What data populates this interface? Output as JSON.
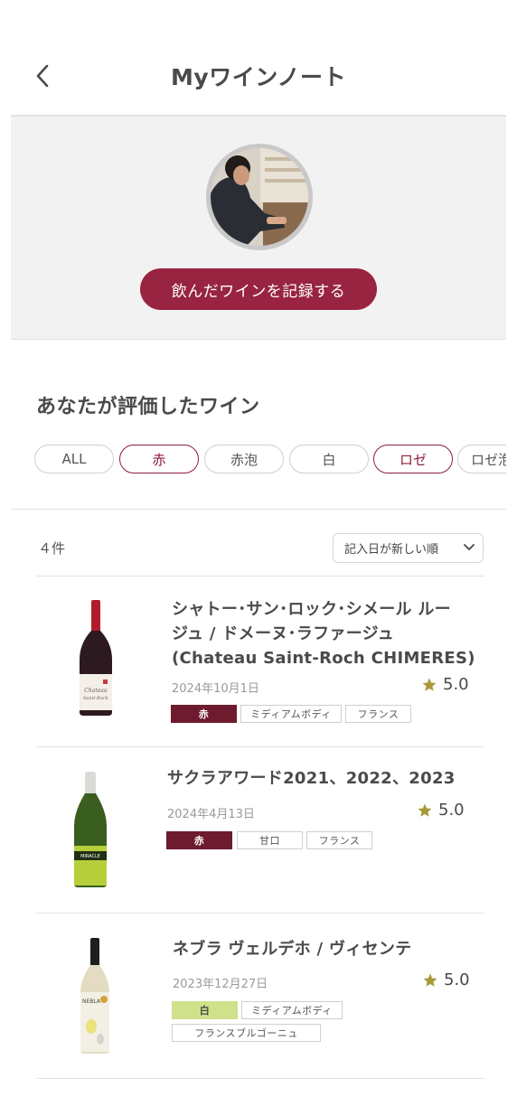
{
  "header": {
    "title": "Myワインノート",
    "back_icon": "chevron-left-icon"
  },
  "profile": {
    "record_button_label": "飲んだワインを記録する"
  },
  "section": {
    "title": "あなたが評価したワイン"
  },
  "filters": [
    {
      "label": "ALL",
      "active": false
    },
    {
      "label": "赤",
      "active": true
    },
    {
      "label": "赤泡",
      "active": false
    },
    {
      "label": "白",
      "active": false
    },
    {
      "label": "ロゼ",
      "active": true
    },
    {
      "label": "ロゼ泡",
      "active": false
    }
  ],
  "list": {
    "count": "４件",
    "sort_label": "記入日が新しい順"
  },
  "colors": {
    "accent": "#982441",
    "red_tag": "#6e1b30",
    "white_tag": "#cfe18b",
    "star": "#a89a3a"
  },
  "wines": [
    {
      "name_line1": "シャトー･サン･ロック･シメール ルー",
      "name_line2": "ジュ / ドメーヌ･ラファージュ",
      "name_line3": "(Chateau Saint-Roch CHIMERES)",
      "date": "2024年10月1日",
      "rating": "5.0",
      "tags": [
        "赤",
        "ミディアムボディ",
        "フランス"
      ]
    },
    {
      "name_line1": "サクラアワード2021、2022、2023",
      "date": "2024年4月13日",
      "rating": "5.0",
      "tags": [
        "赤",
        "甘口",
        "フランス"
      ]
    },
    {
      "name_line1": "ネブラ ヴェルデホ / ヴィセンテ",
      "date": "2023年12月27日",
      "rating": "5.0",
      "tags": [
        "白",
        "ミディアムボディ",
        "フランスブルゴーニュ"
      ]
    }
  ]
}
